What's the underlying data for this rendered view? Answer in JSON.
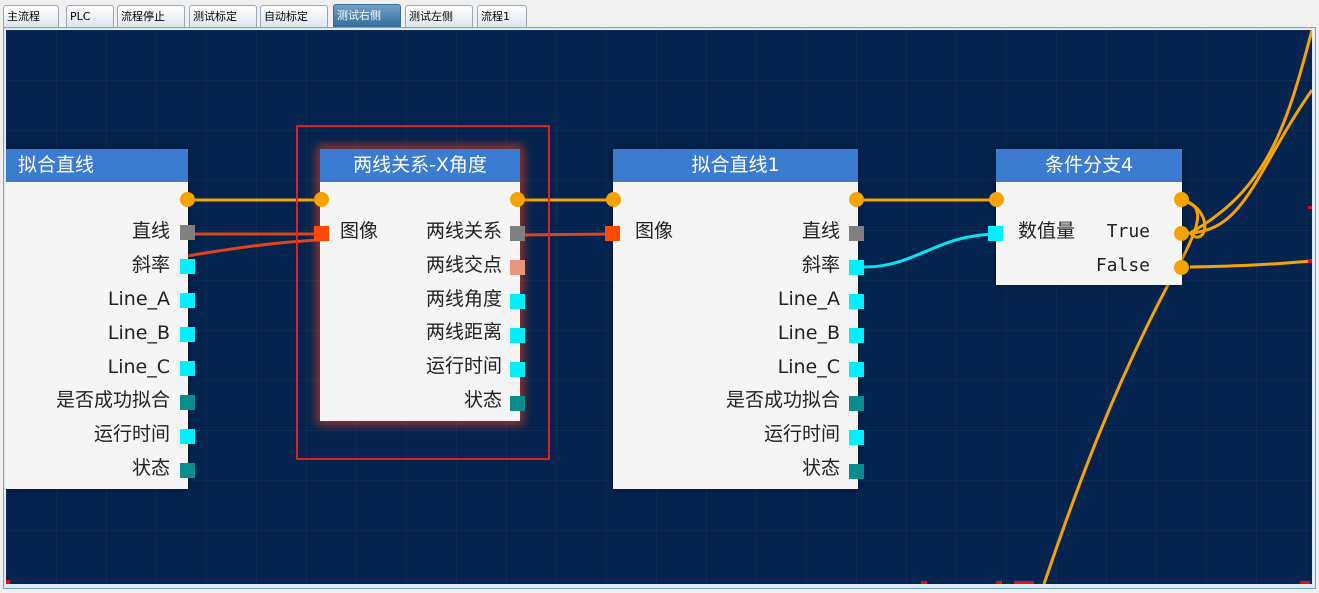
{
  "tabs": [
    {
      "label": "主流程"
    },
    {
      "label": "PLC"
    },
    {
      "label": "流程停止"
    },
    {
      "label": "测试标定"
    },
    {
      "label": "自动标定"
    },
    {
      "label": "测试右侧",
      "active": true
    },
    {
      "label": "测试左侧"
    },
    {
      "label": "流程1"
    }
  ],
  "nodes": {
    "fit_line": {
      "title": "拟合直线",
      "outputs": [
        "直线",
        "斜率",
        "Line_A",
        "Line_B",
        "Line_C",
        "是否成功拟合",
        "运行时间",
        "状态"
      ]
    },
    "two_line": {
      "title": "两线关系-X角度",
      "input": "图像",
      "outputs": [
        "两线关系",
        "两线交点",
        "两线角度",
        "两线距离",
        "运行时间",
        "状态"
      ]
    },
    "fit_line1": {
      "title": "拟合直线1",
      "input": "图像",
      "outputs": [
        "直线",
        "斜率",
        "Line_A",
        "Line_B",
        "Line_C",
        "是否成功拟合",
        "运行时间",
        "状态"
      ]
    },
    "cond": {
      "title": "条件分支4",
      "input": "数值量",
      "outputs": [
        "True",
        "False"
      ]
    }
  },
  "colors": {
    "canvas": "#04244f",
    "title_bar": "#3b7bd1",
    "flow_wire": "#f5a300",
    "line_wire": "#e0451a",
    "value_wire": "#00e5f5",
    "port_cyan": "#00f0ff",
    "port_teal": "#0b8c8c",
    "port_gray": "#808080",
    "port_orange": "#ff4a00",
    "port_salmon": "#e8957a",
    "selection": "#e02020"
  }
}
